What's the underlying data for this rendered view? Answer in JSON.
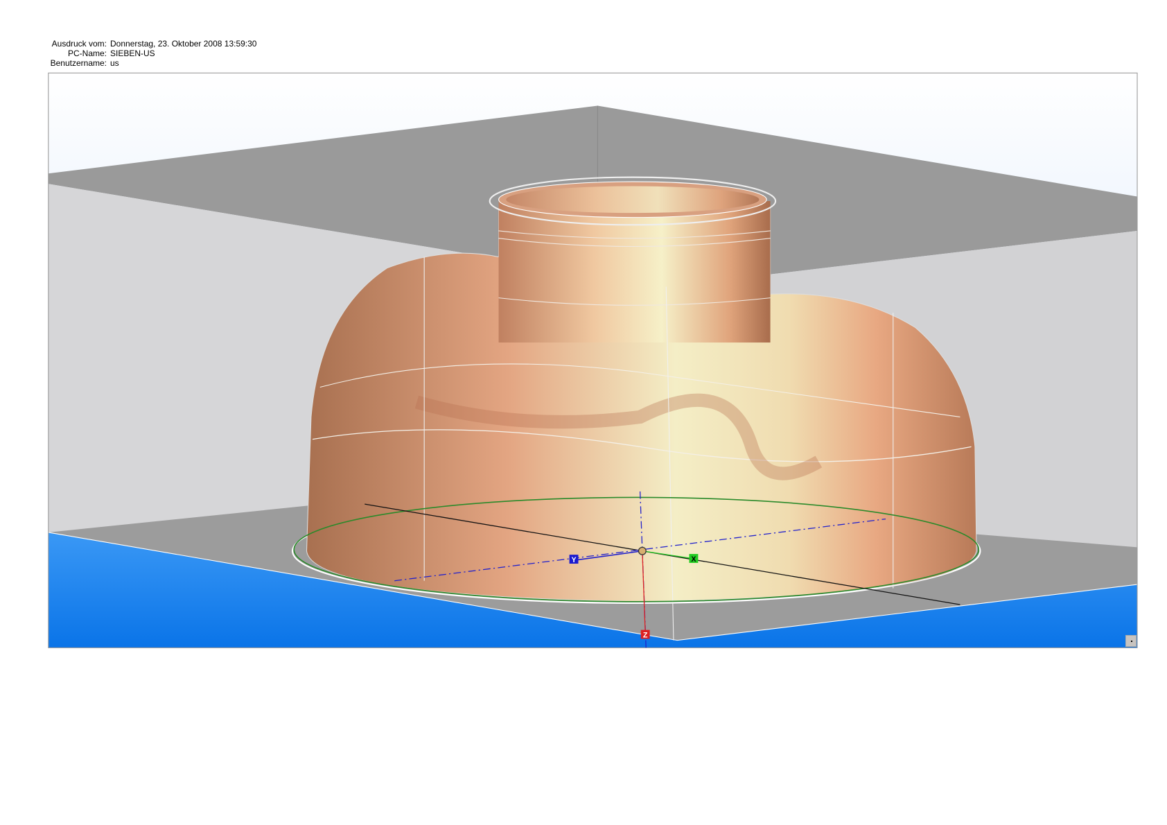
{
  "header": {
    "print_label": "Ausdruck vom:",
    "print_value": "Donnerstag, 23. Oktober 2008 13:59:30",
    "pc_label": "PC-Name:",
    "pc_value": "SIEBEN-US",
    "user_label": "Benutzername:",
    "user_value": "us"
  },
  "viewport": {
    "axes": {
      "x": "X",
      "y": "Y",
      "z": "Z"
    },
    "colors": {
      "part": "#e0a07a",
      "part_highlight": "#f3ecc4",
      "floor_blue": "#1a80ee",
      "axis_x": "#22cc22",
      "axis_y": "#1a1ad0",
      "axis_z": "#dd2020"
    }
  }
}
